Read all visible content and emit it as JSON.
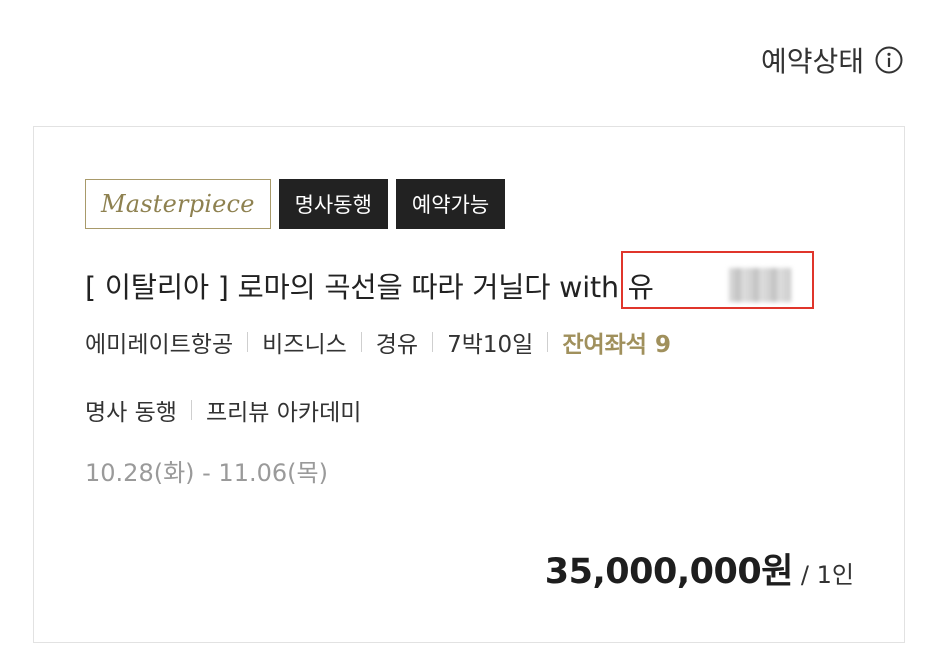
{
  "header": {
    "status_label": "예약상태",
    "info_icon": "info-circle-icon"
  },
  "card": {
    "badges": {
      "masterpiece": "Masterpiece",
      "mentor": "명사동행",
      "availability": "예약가능"
    },
    "title": {
      "main": "[ 이탈리아 ] 로마의 곡선을 따라 거닐다 ",
      "guest": "with 유"
    },
    "meta": {
      "airline": "에미레이트항공",
      "cabin": "비즈니스",
      "route": "경유",
      "duration": "7박10일",
      "seats": "잔여좌석 9"
    },
    "features": {
      "mentor": "명사 동행",
      "academy": "프리뷰 아카데미"
    },
    "dates": "10.28(화) - 11.06(목)",
    "price": "35,000,000원",
    "per_person": "/ 1인"
  },
  "colors": {
    "gold": "#a0905c",
    "highlight": "#e0352b",
    "dark_badge": "#222222"
  }
}
